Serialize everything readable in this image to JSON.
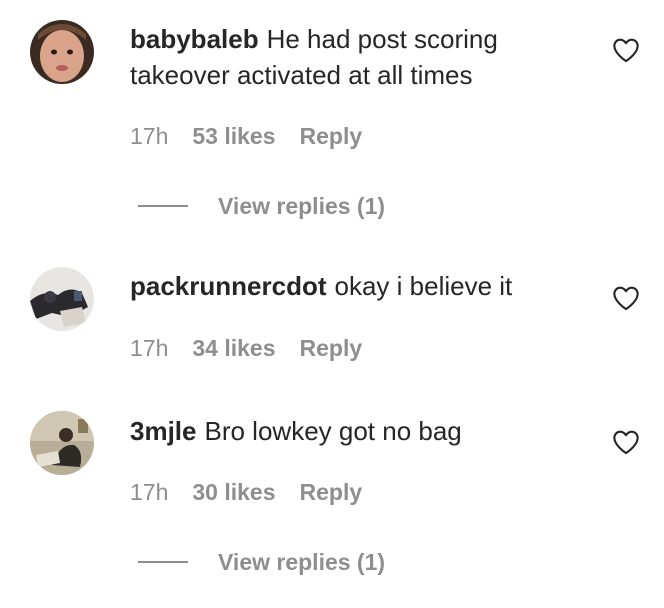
{
  "comments": [
    {
      "username": "babybaleb",
      "text": "He had post scoring takeover activated at all times",
      "time": "17h",
      "likes": "53 likes",
      "reply_label": "Reply",
      "view_replies": "View replies (1)",
      "avatar_icon": "child-face-avatar",
      "heart_icon": "heart-outline-icon"
    },
    {
      "username": "packrunnercdot",
      "text": "okay i believe it",
      "time": "17h",
      "likes": "34 likes",
      "reply_label": "Reply",
      "avatar_icon": "photo-avatar",
      "heart_icon": "heart-outline-icon"
    },
    {
      "username": "3mjle",
      "text": "Bro lowkey got no bag",
      "time": "17h",
      "likes": "30 likes",
      "reply_label": "Reply",
      "view_replies": "View replies (1)",
      "avatar_icon": "photo-avatar",
      "heart_icon": "heart-outline-icon"
    }
  ],
  "colors": {
    "text": "#262626",
    "secondary": "#8e8e8e",
    "background": "#ffffff"
  }
}
